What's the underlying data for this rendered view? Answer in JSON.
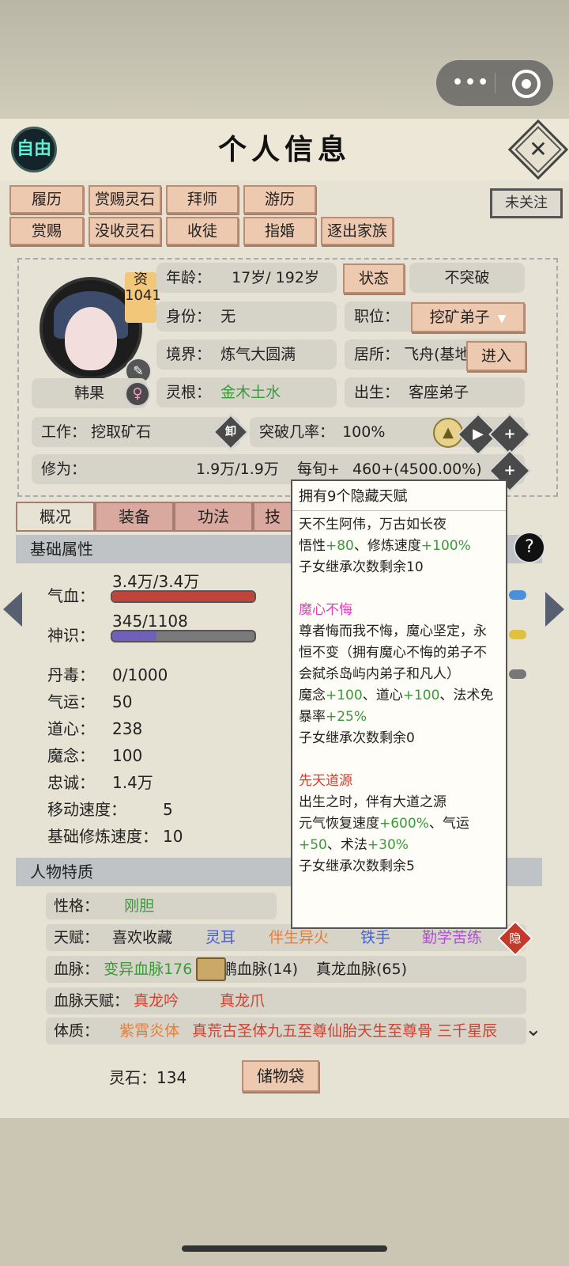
{
  "header": {
    "title": "个人信息",
    "free_label": "自由",
    "close_label": "✕"
  },
  "follow_label": "未关注",
  "actions_row1": [
    "履历",
    "赏赐灵石",
    "拜师",
    "游历"
  ],
  "actions_row2": [
    "赏赐",
    "没收灵石",
    "收徒",
    "指婚",
    "逐出家族"
  ],
  "profile": {
    "zi_label": "资",
    "zi_value": "1041",
    "name": "韩果",
    "gender_icon": "♀",
    "age_label": "年龄：",
    "age_value": "17岁/ 192岁",
    "status_button": "状态",
    "breakthrough_state": "不突破",
    "identity_label": "身份：",
    "identity_value": "无",
    "position_label": "职位：",
    "position_value": "挖矿弟子",
    "realm_label": "境界：",
    "realm_value": "炼气大圆满",
    "residence_label": "居所：",
    "residence_value": "飞舟(基地",
    "enter_button": "进入",
    "root_label": "灵根：",
    "root_value": "金木土水",
    "birth_label": "出生：",
    "birth_value": "客座弟子",
    "work_label": "工作：",
    "work_value": "挖取矿石",
    "unload_label": "卸",
    "break_rate_label": "突破几率：",
    "break_rate_value": "100%",
    "cultivation_label": "修为：",
    "cultivation_value": "1.9万/1.9万",
    "per_tick_label": "每旬+",
    "per_tick_value": "460+(4500.00%)"
  },
  "tabs": [
    "概况",
    "装备",
    "功法",
    "技"
  ],
  "basic": {
    "section_title": "基础属性",
    "hp_label": "气血：",
    "hp_value": "3.4万/3.4万",
    "hp_fraction": 1.0,
    "sense_label": "神识：",
    "sense_value": "345/1108",
    "sense_fraction": 0.31,
    "stats": [
      {
        "label": "丹毒：",
        "value": "0/1000"
      },
      {
        "label": "气运：",
        "value": "50"
      },
      {
        "label": "道心：",
        "value": "238"
      },
      {
        "label": "魔念：",
        "value": "100"
      },
      {
        "label": "忠诚：",
        "value": "1.4万"
      },
      {
        "label": "移动速度：",
        "value": "5"
      },
      {
        "label": "基础修炼速度：",
        "value": "10"
      }
    ]
  },
  "traits": {
    "section_title": "人物特质",
    "personality_label": "性格：",
    "personality_value": "刚胆",
    "talent_label": "天赋：",
    "talents": [
      "喜欢收藏",
      "灵耳",
      "伴生异火",
      "铁手",
      "勤学苦练"
    ],
    "hidden_label": "隐",
    "blood_label": "血脉：",
    "blood_1": "变异血脉176",
    "blood_2": "鲲鹏血脉(14)",
    "blood_3": "真龙血脉(65)",
    "blood_talent_label": "血脉天赋：",
    "blood_talents": [
      "真龙吟",
      "真龙爪"
    ],
    "constitution_label": "体质：",
    "constitution_1": "紫霄炎体",
    "constitution_rest": "真荒古圣体九五至尊仙胎天生至尊骨 三千星辰"
  },
  "bottom": {
    "spirit_label": "灵石：",
    "spirit_value": "134",
    "bag_button": "储物袋"
  },
  "tooltip": {
    "header": "拥有9个隐藏天赋",
    "t1_line1": "天不生阿伟，万古如长夜",
    "t1_a": "悟性",
    "t1_a_v": "+80",
    "t1_sep": "、修炼速度",
    "t1_b_v": "+100%",
    "t1_inherit": "子女继承次数剩余10",
    "t2_name": "魔心不悔",
    "t2_desc": "尊者悔而我不悔，魔心坚定，永恒不变（拥有魔心不悔的弟子不会弑杀岛屿内弟子和凡人）",
    "t2_a": "魔念",
    "t2_a_v": "+100",
    "t2_sep1": "、道心",
    "t2_b_v": "+100",
    "t2_sep2": "、法术免暴率",
    "t2_c_v": "+25%",
    "t2_inherit": "子女继承次数剩余0",
    "t3_name": "先天道源",
    "t3_desc": "出生之时，伴有大道之源",
    "t3_a": "元气恢复速度",
    "t3_a_v": "+600%",
    "t3_sep1": "、气运",
    "t3_b_v": "+50",
    "t3_sep2": "、术法",
    "t3_c_v": "+30%",
    "t3_inherit": "子女继承次数剩余5"
  }
}
